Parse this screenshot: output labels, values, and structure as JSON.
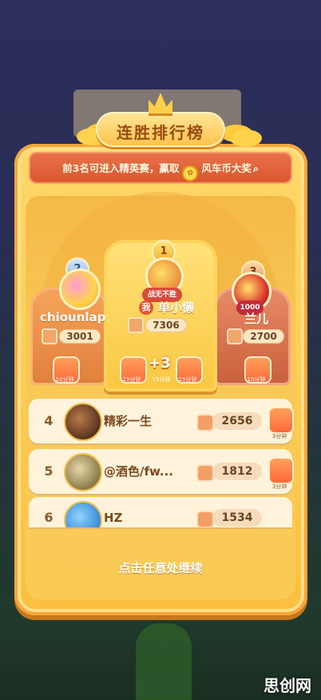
{
  "title": "连胜排行榜",
  "banner": {
    "text_before": "前3名可进入精英赛，赢取",
    "coin_icon": "windmill-coin-icon",
    "text_after": "风车币大奖",
    "info_icon": "magnifier-icon"
  },
  "podium": [
    {
      "rank": "2",
      "name": "chiounlap",
      "score": "3001",
      "reward_label": "10分钟"
    },
    {
      "rank": "1",
      "name": "单小懒",
      "me_badge": "我",
      "title_tag": "战无不胜",
      "score": "7306",
      "bonus": "+3",
      "reward_labels": [
        "15分钟",
        "15分钟",
        "15分钟"
      ]
    },
    {
      "rank": "3",
      "name": "兰儿",
      "level_tag": "1000",
      "score": "2700",
      "reward_label": "10分钟"
    }
  ],
  "rows": [
    {
      "rank": "4",
      "name": "精彩一生",
      "score": "2656",
      "reward_label": "3分钟"
    },
    {
      "rank": "5",
      "name": "@酒色/fw...",
      "score": "1812",
      "reward_label": "3分钟"
    },
    {
      "rank": "6",
      "name": "HZ",
      "score": "1534",
      "reward_label": ""
    }
  ],
  "continue_text": "点击任意处继续",
  "watermark": "思创网",
  "colors": {
    "panel": "#ffd86b",
    "banner": "#d9552d",
    "row": "#fff3db",
    "text": "#7a4a1e"
  }
}
